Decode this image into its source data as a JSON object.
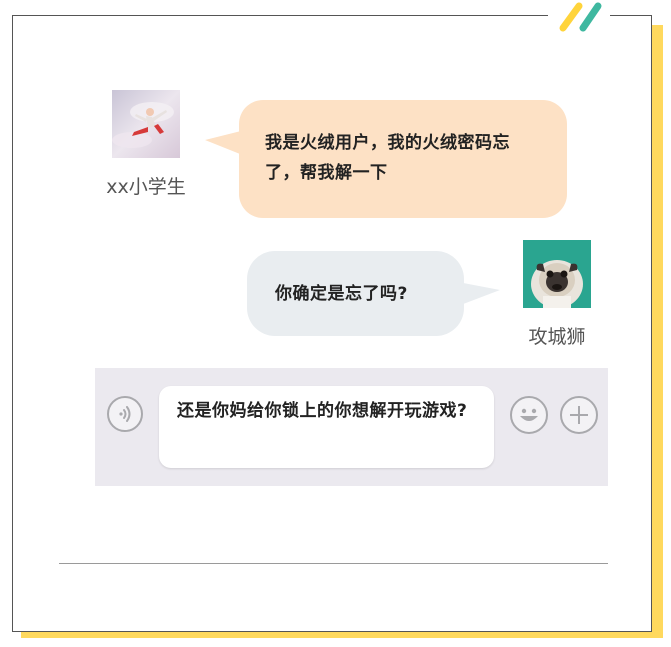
{
  "conversation": {
    "user": {
      "name": "xx小学生",
      "avatar_icon": "dancer-avatar-icon",
      "message": "我是火绒用户，我的火绒密码忘了，帮我解一下",
      "bubble_color": "#fde1c5"
    },
    "reply": {
      "name": "攻城狮",
      "avatar_icon": "pug-dog-avatar-icon",
      "message": "你确定是忘了吗?",
      "bubble_color": "#e9edf0"
    }
  },
  "input_bar": {
    "text": "还是你妈给你锁上的你想解开玩游戏?",
    "voice_icon": "voice-icon",
    "emoji_icon": "smiley-icon",
    "add_icon": "plus-icon",
    "background": "#ebe9ef"
  },
  "theme": {
    "accent_yellow": "#ffd95e",
    "accent_green": "#3fb8a0"
  }
}
